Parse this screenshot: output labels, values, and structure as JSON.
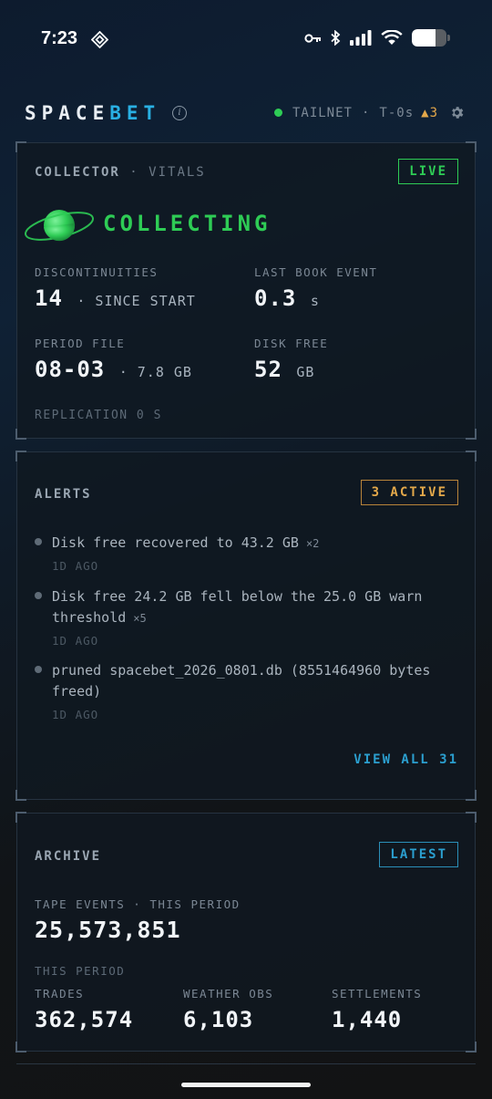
{
  "status_bar": {
    "time": "7:23"
  },
  "header": {
    "brand_a": "SPACE",
    "brand_b": "BET",
    "network": "TAILNET",
    "separator": "·",
    "t_label": "T-0s",
    "warnings": "▲3"
  },
  "collector": {
    "title": "COLLECTOR",
    "title_sub": "· VITALS",
    "badge": "LIVE",
    "status": "COLLECTING",
    "discontinuities_label": "DISCONTINUITIES",
    "discontinuities_value": "14",
    "discontinuities_suffix": "· SINCE START",
    "last_book_label": "LAST BOOK EVENT",
    "last_book_value": "0.3",
    "last_book_unit": "s",
    "period_file_label": "PERIOD FILE",
    "period_file_value": "08-03",
    "period_file_suffix": "· 7.8 GB",
    "disk_free_label": "DISK FREE",
    "disk_free_value": "52",
    "disk_free_unit": "GB",
    "replication": "REPLICATION 0 S"
  },
  "alerts": {
    "title": "ALERTS",
    "badge": "3 ACTIVE",
    "items": [
      {
        "text": "Disk free recovered to 43.2 GB",
        "count": "×2",
        "time": "1D AGO"
      },
      {
        "text": "Disk free 24.2 GB fell below the 25.0 GB warn threshold",
        "count": "×5",
        "time": "1D AGO"
      },
      {
        "text": "pruned spacebet_2026_0801.db (8551464960 bytes freed)",
        "count": "",
        "time": "1D AGO"
      }
    ],
    "view_all": "VIEW ALL 31"
  },
  "archive": {
    "title": "ARCHIVE",
    "badge": "LATEST",
    "tape_label": "TAPE EVENTS · THIS PERIOD",
    "tape_value": "25,573,851",
    "period_label": "THIS PERIOD",
    "trades_label": "TRADES",
    "trades_value": "362,574",
    "weather_label": "WEATHER OBS",
    "weather_value": "6,103",
    "settlements_label": "SETTLEMENTS",
    "settlements_value": "1,440"
  },
  "colors": {
    "accent_blue": "#29b0e3",
    "live_green": "#2ecc55",
    "warning_amber": "#e3a84a",
    "link_blue": "#2b9fcf"
  }
}
